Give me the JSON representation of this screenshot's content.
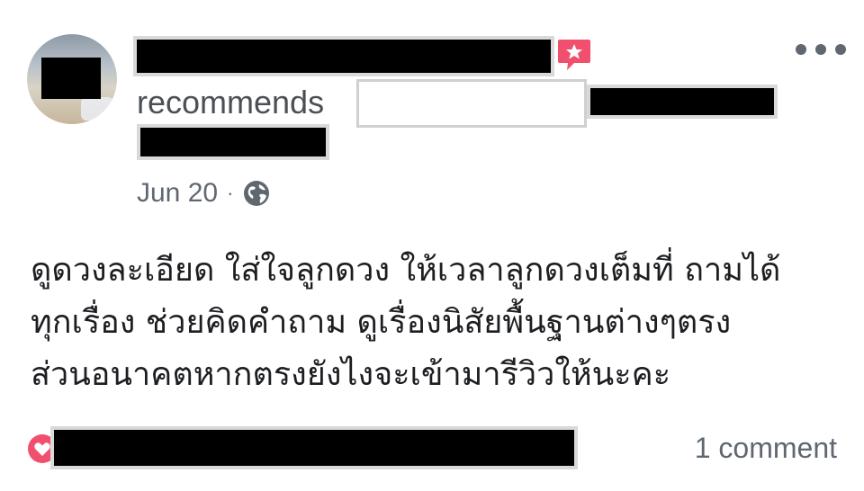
{
  "post": {
    "recommends_label": "recommends",
    "date": "Jun 20",
    "separator": "·",
    "privacy_icon": "globe-icon",
    "text_lines": [
      "ดูดวงละเอียด ใส่ใจลูกดวง ให้เวลาลูกดวงเต็มที่ ถามได้",
      "ทุกเรื่อง ช่วยคิดคำถาม ดูเรื่องนิสัยพื้นฐานต่างๆตรง",
      "ส่วนอนาคตหากตรงยังไงจะเข้ามารีวิวให้นะคะ"
    ],
    "comment_count": "1 comment"
  },
  "icons": {
    "recommend_badge": "recommendation-star-badge-icon",
    "more": "more-options-icon",
    "reaction": "love-reaction-icon"
  },
  "colors": {
    "badge": "#f0506e",
    "reaction": "#f0506e",
    "meta_text": "#606770"
  }
}
